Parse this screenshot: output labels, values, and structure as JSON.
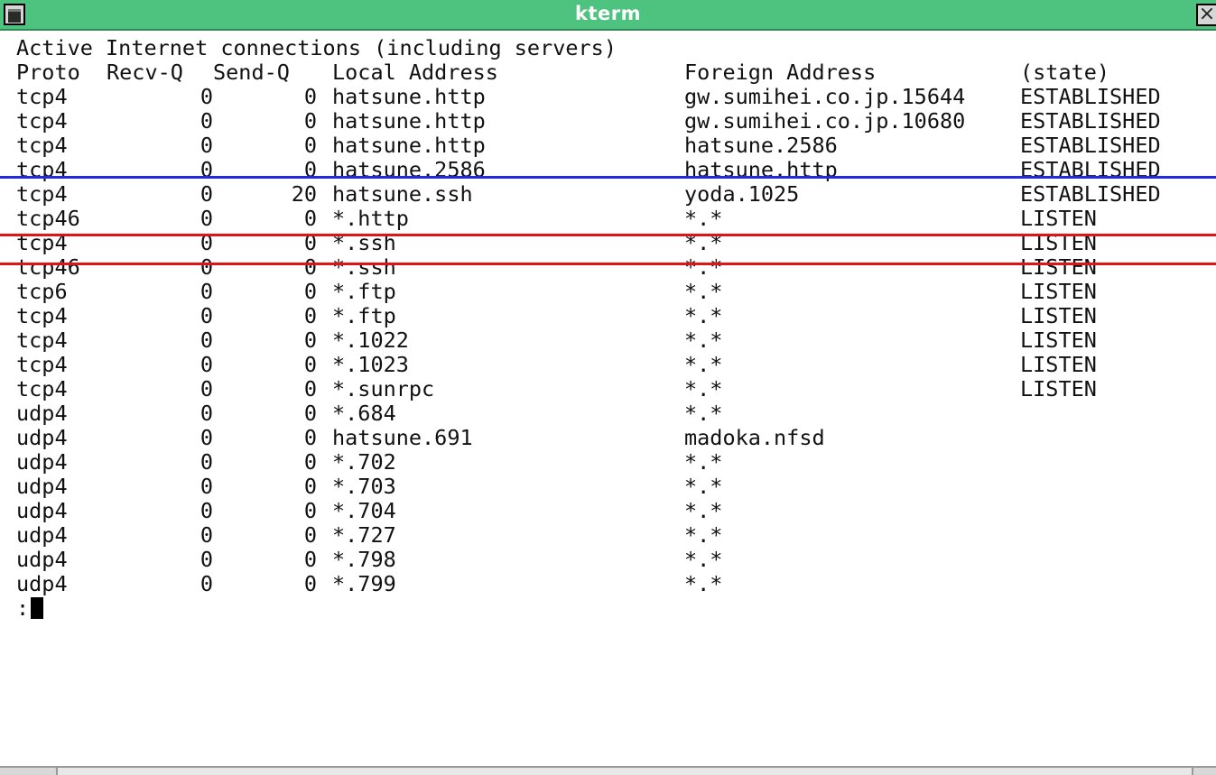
{
  "window": {
    "title": "kterm",
    "menu_icon": "window-menu-icon",
    "close_icon": "close-icon",
    "close_glyph": "×"
  },
  "terminal": {
    "heading": "Active Internet connections (including servers)",
    "columns": {
      "proto": "Proto",
      "recvq": "Recv-Q",
      "sendq": "Send-Q",
      "local": "Local Address",
      "foreign": "Foreign Address",
      "state": "(state)"
    },
    "rows": [
      {
        "proto": "tcp4",
        "recvq": "0",
        "sendq": "0",
        "local": "hatsune.http",
        "foreign": "gw.sumihei.co.jp.15644",
        "state": "ESTABLISHED"
      },
      {
        "proto": "tcp4",
        "recvq": "0",
        "sendq": "0",
        "local": "hatsune.http",
        "foreign": "gw.sumihei.co.jp.10680",
        "state": "ESTABLISHED"
      },
      {
        "proto": "tcp4",
        "recvq": "0",
        "sendq": "0",
        "local": "hatsune.http",
        "foreign": "hatsune.2586",
        "state": "ESTABLISHED"
      },
      {
        "proto": "tcp4",
        "recvq": "0",
        "sendq": "0",
        "local": "hatsune.2586",
        "foreign": "hatsune.http",
        "state": "ESTABLISHED"
      },
      {
        "proto": "tcp4",
        "recvq": "0",
        "sendq": "20",
        "local": "hatsune.ssh",
        "foreign": "yoda.1025",
        "state": "ESTABLISHED"
      },
      {
        "proto": "tcp46",
        "recvq": "0",
        "sendq": "0",
        "local": "*.http",
        "foreign": "*.*",
        "state": "LISTEN"
      },
      {
        "proto": "tcp4",
        "recvq": "0",
        "sendq": "0",
        "local": "*.ssh",
        "foreign": "*.*",
        "state": "LISTEN"
      },
      {
        "proto": "tcp46",
        "recvq": "0",
        "sendq": "0",
        "local": "*.ssh",
        "foreign": "*.*",
        "state": "LISTEN"
      },
      {
        "proto": "tcp6",
        "recvq": "0",
        "sendq": "0",
        "local": "*.ftp",
        "foreign": "*.*",
        "state": "LISTEN"
      },
      {
        "proto": "tcp4",
        "recvq": "0",
        "sendq": "0",
        "local": "*.ftp",
        "foreign": "*.*",
        "state": "LISTEN"
      },
      {
        "proto": "tcp4",
        "recvq": "0",
        "sendq": "0",
        "local": "*.1022",
        "foreign": "*.*",
        "state": "LISTEN"
      },
      {
        "proto": "tcp4",
        "recvq": "0",
        "sendq": "0",
        "local": "*.1023",
        "foreign": "*.*",
        "state": "LISTEN"
      },
      {
        "proto": "tcp4",
        "recvq": "0",
        "sendq": "0",
        "local": "*.sunrpc",
        "foreign": "*.*",
        "state": "LISTEN"
      },
      {
        "proto": "udp4",
        "recvq": "0",
        "sendq": "0",
        "local": "*.684",
        "foreign": "*.*",
        "state": ""
      },
      {
        "proto": "udp4",
        "recvq": "0",
        "sendq": "0",
        "local": "hatsune.691",
        "foreign": "madoka.nfsd",
        "state": ""
      },
      {
        "proto": "udp4",
        "recvq": "0",
        "sendq": "0",
        "local": "*.702",
        "foreign": "*.*",
        "state": ""
      },
      {
        "proto": "udp4",
        "recvq": "0",
        "sendq": "0",
        "local": "*.703",
        "foreign": "*.*",
        "state": ""
      },
      {
        "proto": "udp4",
        "recvq": "0",
        "sendq": "0",
        "local": "*.704",
        "foreign": "*.*",
        "state": ""
      },
      {
        "proto": "udp4",
        "recvq": "0",
        "sendq": "0",
        "local": "*.727",
        "foreign": "*.*",
        "state": ""
      },
      {
        "proto": "udp4",
        "recvq": "0",
        "sendq": "0",
        "local": "*.798",
        "foreign": "*.*",
        "state": ""
      },
      {
        "proto": "udp4",
        "recvq": "0",
        "sendq": "0",
        "local": "*.799",
        "foreign": "*.*",
        "state": ""
      }
    ],
    "prompt": ":"
  },
  "colors": {
    "titlebar": "#4ec27f",
    "highlight_blue": "#1f2be0",
    "highlight_red": "#e01414"
  }
}
